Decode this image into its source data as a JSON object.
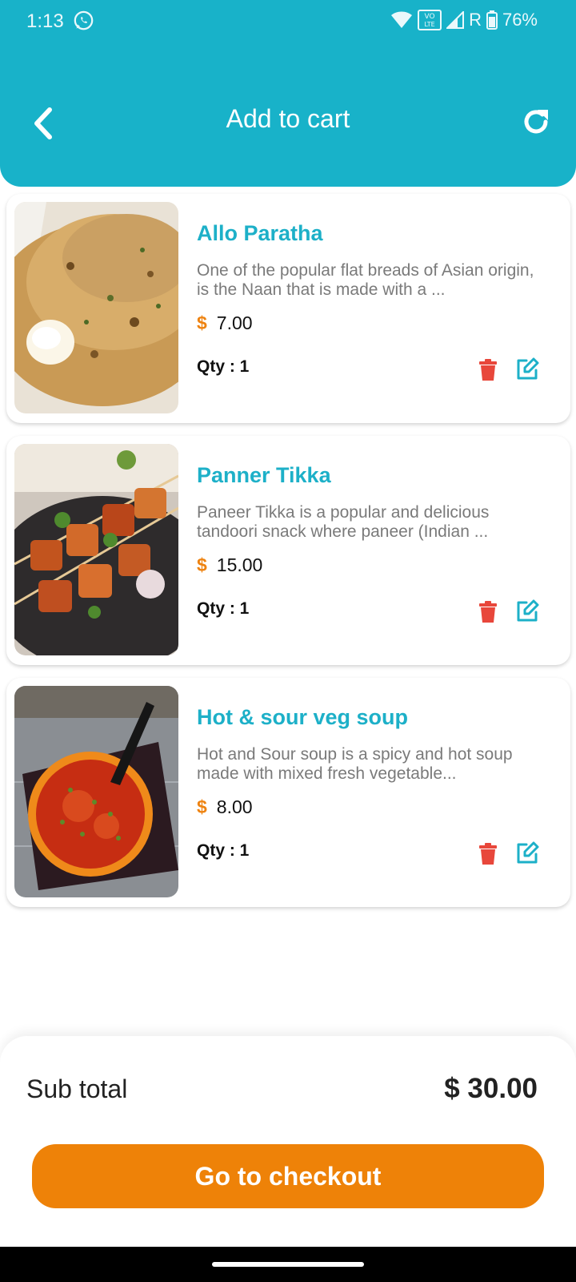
{
  "status_bar": {
    "time": "1:13",
    "battery": "76%",
    "network": "R",
    "icons": [
      "whatsapp-icon",
      "wifi-icon",
      "volte-icon",
      "signal-icon",
      "battery-icon"
    ]
  },
  "header": {
    "title": "Add to cart",
    "back_icon": "chevron-left-icon",
    "refresh_icon": "refresh-icon",
    "color": "#18b2c9"
  },
  "cart": {
    "items": [
      {
        "name": "Allo Paratha",
        "description": "One of the popular flat breads of Asian origin, is the Naan that is made with a ...",
        "currency": "$",
        "price": "7.00",
        "qty": "Qty : 1",
        "image": "paratha-photo"
      },
      {
        "name": "Panner Tikka",
        "description": "Paneer Tikka is a popular and delicious tandoori snack where paneer (Indian ...",
        "currency": "$",
        "price": "15.00",
        "qty": "Qty : 1",
        "image": "paneer-tikka-photo"
      },
      {
        "name": "Hot & sour veg soup",
        "description": "Hot and Sour soup is a spicy and hot soup made with mixed fresh vegetable...",
        "currency": "$",
        "price": "8.00",
        "qty": "Qty : 1",
        "image": "soup-photo"
      }
    ]
  },
  "summary": {
    "subtotal_label": "Sub total",
    "subtotal_value": "$ 30.00",
    "checkout_label": "Go to checkout"
  },
  "colors": {
    "accent": "#18b2c9",
    "price": "#ee8311",
    "checkout": "#ee8208",
    "delete": "#e8473b"
  }
}
